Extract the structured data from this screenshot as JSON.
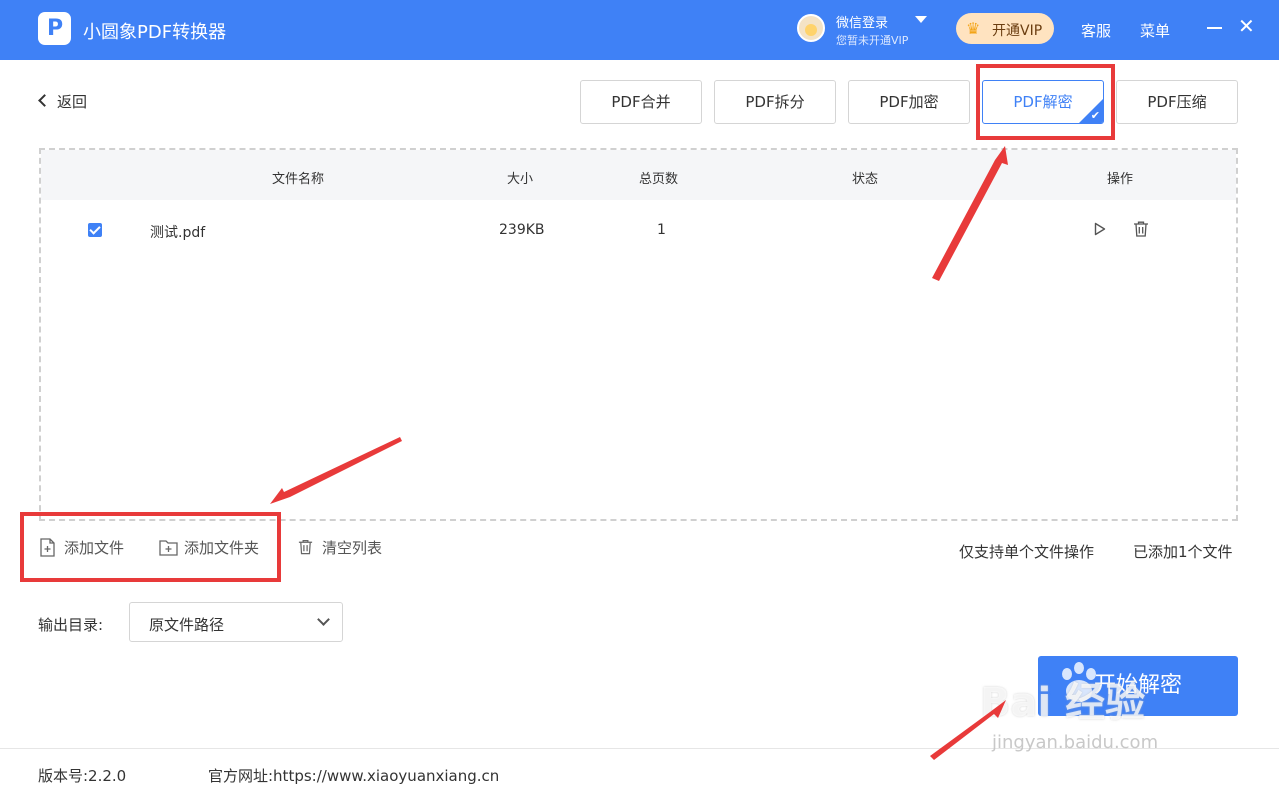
{
  "titlebar": {
    "app_title": "小圆象PDF转换器",
    "logo_letter": "P",
    "login_name": "微信登录",
    "login_sub": "您暂未开通VIP",
    "vip_label": "开通VIP",
    "service": "客服",
    "menu": "菜单"
  },
  "nav": {
    "back": "返回"
  },
  "tools": [
    {
      "label": "PDF合并",
      "active": false
    },
    {
      "label": "PDF拆分",
      "active": false
    },
    {
      "label": "PDF加密",
      "active": false
    },
    {
      "label": "PDF解密",
      "active": true
    },
    {
      "label": "PDF压缩",
      "active": false
    }
  ],
  "file_list": {
    "columns": [
      "文件名称",
      "大小",
      "总页数",
      "状态",
      "操作"
    ],
    "rows": [
      {
        "checked": true,
        "name": "测试.pdf",
        "size": "239KB",
        "pages": "1",
        "status": ""
      }
    ]
  },
  "actions": {
    "add_file": "添加文件",
    "add_folder": "添加文件夹",
    "clear_list": "清空列表",
    "single_hint": "仅支持单个文件操作",
    "added_count": "已添加1个文件"
  },
  "output": {
    "label": "输出目录:",
    "selected": "原文件路径"
  },
  "start_button": "开始解密",
  "footer": {
    "version": "版本号:2.2.0",
    "website": "官方网址:https://www.xiaoyuanxiang.cn"
  },
  "watermark": {
    "brand": "Bai  经验",
    "url": "jingyan.baidu.com"
  },
  "colors": {
    "primary": "#3f81f6",
    "annotation": "#e83a3a",
    "vip_bg": "#ffe3c0"
  }
}
